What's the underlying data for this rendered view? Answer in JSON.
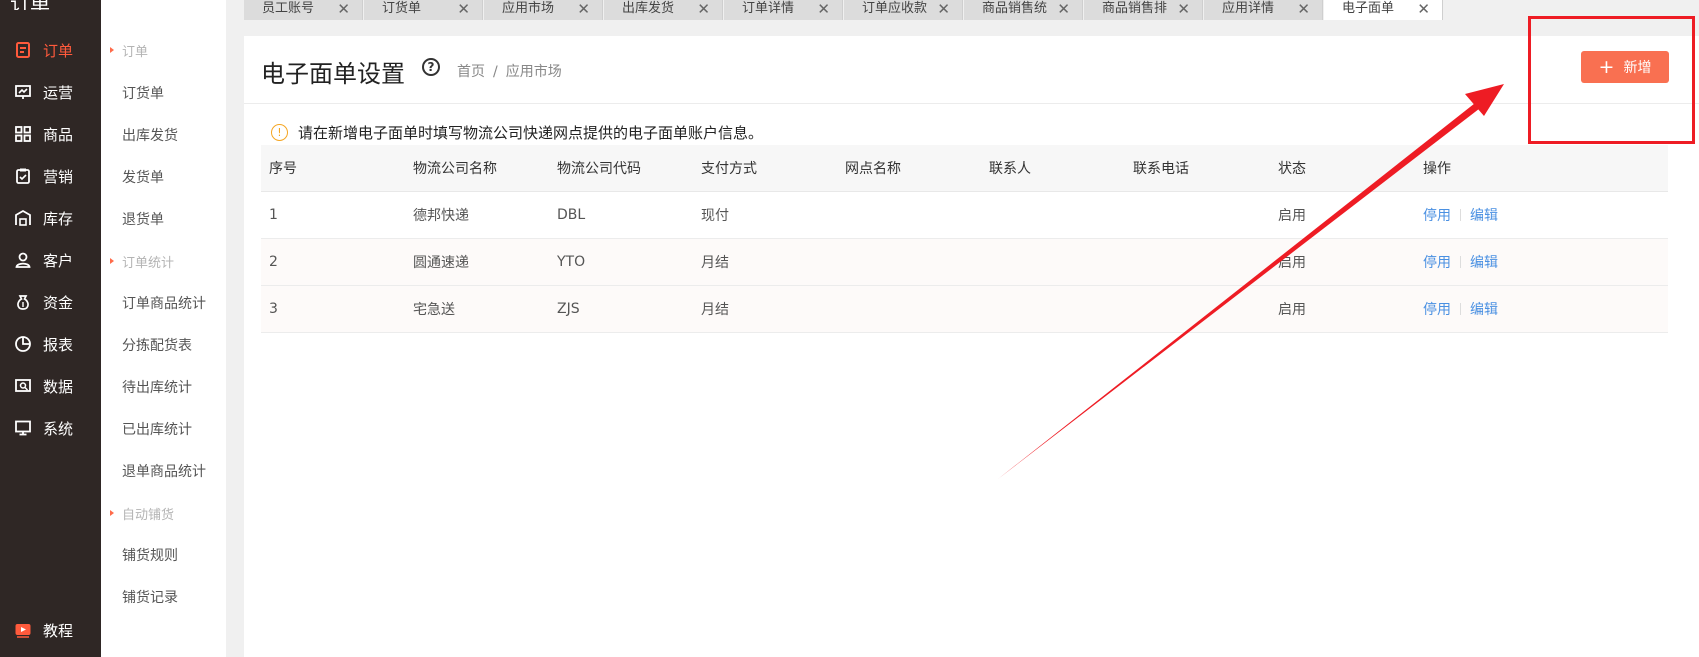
{
  "nav": {
    "logo": "订单",
    "items": [
      {
        "label": "订单",
        "icon": "document-icon",
        "active": true
      },
      {
        "label": "运营",
        "icon": "chart-board-icon"
      },
      {
        "label": "商品",
        "icon": "grid-icon"
      },
      {
        "label": "营销",
        "icon": "clipboard-icon"
      },
      {
        "label": "库存",
        "icon": "warehouse-icon"
      },
      {
        "label": "客户",
        "icon": "user-icon"
      },
      {
        "label": "资金",
        "icon": "money-bag-icon"
      },
      {
        "label": "报表",
        "icon": "pie-chart-icon"
      },
      {
        "label": "数据",
        "icon": "data-icon"
      },
      {
        "label": "系统",
        "icon": "monitor-icon"
      }
    ],
    "tutorial": "教程"
  },
  "submenu": {
    "groups": [
      "订单",
      "订单统计",
      "自动铺货"
    ],
    "items": [
      "订货单",
      "出库发货",
      "发货单",
      "退货单",
      "订单商品统计",
      "分拣配货表",
      "待出库统计",
      "已出库统计",
      "退单商品统计",
      "铺货规则",
      "铺货记录"
    ]
  },
  "tabs": [
    {
      "label": "员工账号"
    },
    {
      "label": "订货单"
    },
    {
      "label": "应用市场"
    },
    {
      "label": "出库发货"
    },
    {
      "label": "订单详情"
    },
    {
      "label": "订单应收款"
    },
    {
      "label": "商品销售统"
    },
    {
      "label": "商品销售排"
    },
    {
      "label": "应用详情"
    },
    {
      "label": "电子面单",
      "active": true
    }
  ],
  "header": {
    "title": "电子面单设置",
    "help": "?",
    "breadcrumb": [
      "首页",
      "应用市场"
    ],
    "add_button": "新增"
  },
  "notice": {
    "icon": "warning-icon",
    "text": "请在新增电子面单时填写物流公司快递网点提供的电子面单账户信息。"
  },
  "table": {
    "columns": [
      "序号",
      "物流公司名称",
      "物流公司代码",
      "支付方式",
      "网点名称",
      "联系人",
      "联系电话",
      "状态",
      "操作"
    ],
    "rows": [
      {
        "no": "1",
        "name": "德邦快递",
        "code": "DBL",
        "pay": "现付",
        "site": "",
        "contact": "",
        "phone": "",
        "status": "启用",
        "op1": "停用",
        "op2": "编辑"
      },
      {
        "no": "2",
        "name": "圆通速递",
        "code": "YTO",
        "pay": "月结",
        "site": "",
        "contact": "",
        "phone": "",
        "status": "启用",
        "op1": "停用",
        "op2": "编辑"
      },
      {
        "no": "3",
        "name": "宅急送",
        "code": "ZJS",
        "pay": "月结",
        "site": "",
        "contact": "",
        "phone": "",
        "status": "启用",
        "op1": "停用",
        "op2": "编辑"
      }
    ]
  },
  "colors": {
    "accent": "#f97051",
    "nav_bg": "#2f2725",
    "annotation": "#ee1c24",
    "link": "#4a90e2"
  }
}
